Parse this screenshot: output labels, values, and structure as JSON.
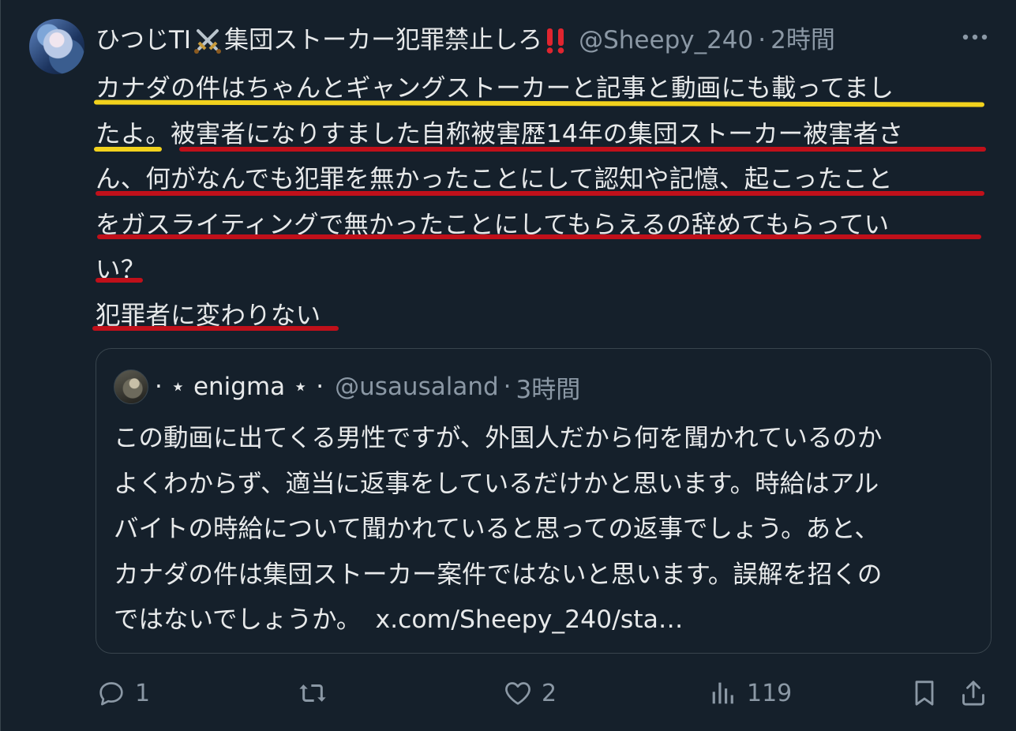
{
  "tweet": {
    "display_name": "ひつじTI",
    "display_name_suffix": "集団ストーカー犯罪禁止しろ",
    "handle": "@Sheepy_240",
    "separator": "·",
    "time": "2時間",
    "body_lines": [
      "カナダの件はちゃんとギャングストーカーと記事と動画にも載ってまし",
      "たよ。被害者になりすました自称被害歴14年の集団ストーカー被害者さ",
      "ん、何がなんでも犯罪を無かったことにして認知や記憶、起こったこと",
      "をガスライティングで無かったことにしてもらえるの辞めてもらってい",
      "い？",
      "犯罪者に変わりない"
    ],
    "colors": {
      "underline_yellow": "#f2d21d",
      "underline_red": "#c0101a",
      "background": "#15202b",
      "muted": "#8b98a5"
    }
  },
  "quote": {
    "display_name": "· ⋆ enigma ⋆ ·",
    "handle": "@usausaland",
    "separator": "·",
    "time": "3時間",
    "body_lines": [
      "この動画に出てくる男性ですが、外国人だから何を聞かれているのか",
      "よくわからず、適当に返事をしているだけかと思います。時給はアル",
      "バイトの時給について聞かれていると思っての返事でしょう。あと、",
      "カナダの件は集団ストーカー案件ではないと思います。誤解を招くの",
      "ではないでしょうか。"
    ],
    "link": "x.com/Sheepy_240/sta…"
  },
  "actions": {
    "reply_count": "1",
    "retweet_count": "",
    "like_count": "2",
    "view_count": "119"
  },
  "icons": [
    "more-icon",
    "swords-icon",
    "double-exclamation-icon",
    "reply-icon",
    "retweet-icon",
    "heart-icon",
    "views-icon",
    "bookmark-icon",
    "share-icon"
  ]
}
